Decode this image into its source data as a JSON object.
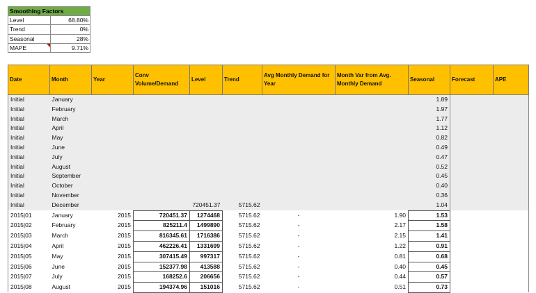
{
  "smoothing": {
    "title": "Smoothing Factors",
    "rows": [
      {
        "label": "Level",
        "value": "68.80%"
      },
      {
        "label": "Trend",
        "value": "0%"
      },
      {
        "label": "Seasonal",
        "value": "28%"
      },
      {
        "label": "MAPE",
        "value": "9.71%"
      }
    ]
  },
  "headers": {
    "date": "Date",
    "month": "Month",
    "year": "Year",
    "conv": "Conv Volume/Demand",
    "level": "Level",
    "trend": "Trend",
    "avg": "Avg Monthly Demand for Year",
    "monthvar": "Month Var from Avg. Monthly Demand",
    "seasonal": "Seasonal",
    "forecast": "Forecast",
    "ape": "APE"
  },
  "initial_rows": [
    {
      "date": "Initial",
      "month": "January",
      "level": "",
      "trend": "",
      "seasonal": "1.89"
    },
    {
      "date": "Initial",
      "month": "February",
      "level": "",
      "trend": "",
      "seasonal": "1.97"
    },
    {
      "date": "Initial",
      "month": "March",
      "level": "",
      "trend": "",
      "seasonal": "1.77"
    },
    {
      "date": "Initial",
      "month": "April",
      "level": "",
      "trend": "",
      "seasonal": "1.12"
    },
    {
      "date": "Initial",
      "month": "May",
      "level": "",
      "trend": "",
      "seasonal": "0.82"
    },
    {
      "date": "Initial",
      "month": "June",
      "level": "",
      "trend": "",
      "seasonal": "0.49"
    },
    {
      "date": "Initial",
      "month": "July",
      "level": "",
      "trend": "",
      "seasonal": "0.47"
    },
    {
      "date": "Initial",
      "month": "August",
      "level": "",
      "trend": "",
      "seasonal": "0.52"
    },
    {
      "date": "Initial",
      "month": "September",
      "level": "",
      "trend": "",
      "seasonal": "0.45"
    },
    {
      "date": "Initial",
      "month": "October",
      "level": "",
      "trend": "",
      "seasonal": "0.40"
    },
    {
      "date": "Initial",
      "month": "November",
      "level": "",
      "trend": "",
      "seasonal": "0.36"
    },
    {
      "date": "Initial",
      "month": "December",
      "level": "720451.37",
      "trend": "5715.62",
      "seasonal": "1.04"
    }
  ],
  "data_rows": [
    {
      "date": "2015|01",
      "month": "January",
      "year": "2015",
      "conv": "720451.37",
      "level": "1274468",
      "trend": "5715.62",
      "avg": "-",
      "monthvar": "1.90",
      "seasonal": "1.53"
    },
    {
      "date": "2015|02",
      "month": "February",
      "year": "2015",
      "conv": "825211.4",
      "level": "1499890",
      "trend": "5715.62",
      "avg": "-",
      "monthvar": "2.17",
      "seasonal": "1.58"
    },
    {
      "date": "2015|03",
      "month": "March",
      "year": "2015",
      "conv": "816345.61",
      "level": "1716386",
      "trend": "5715.62",
      "avg": "-",
      "monthvar": "2.15",
      "seasonal": "1.41"
    },
    {
      "date": "2015|04",
      "month": "April",
      "year": "2015",
      "conv": "462226.41",
      "level": "1331699",
      "trend": "5715.62",
      "avg": "-",
      "monthvar": "1.22",
      "seasonal": "0.91"
    },
    {
      "date": "2015|05",
      "month": "May",
      "year": "2015",
      "conv": "307415.49",
      "level": "997317",
      "trend": "5715.62",
      "avg": "-",
      "monthvar": "0.81",
      "seasonal": "0.68"
    },
    {
      "date": "2015|06",
      "month": "June",
      "year": "2015",
      "conv": "152377.98",
      "level": "413588",
      "trend": "5715.62",
      "avg": "-",
      "monthvar": "0.40",
      "seasonal": "0.45"
    },
    {
      "date": "2015|07",
      "month": "July",
      "year": "2015",
      "conv": "168252.6",
      "level": "206656",
      "trend": "5715.62",
      "avg": "-",
      "monthvar": "0.44",
      "seasonal": "0.57"
    },
    {
      "date": "2015|08",
      "month": "August",
      "year": "2015",
      "conv": "194374.96",
      "level": "151016",
      "trend": "5715.62",
      "avg": "-",
      "monthvar": "0.51",
      "seasonal": "0.73"
    }
  ]
}
